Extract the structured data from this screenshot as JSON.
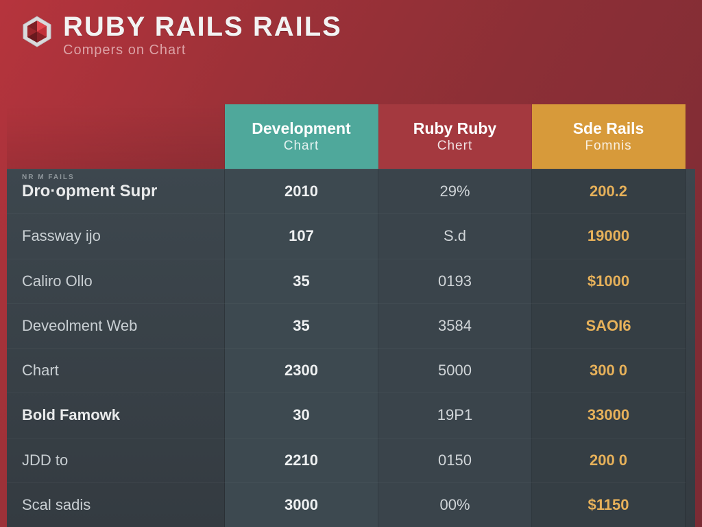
{
  "header": {
    "title": "RUBY RAILS RAILS",
    "subtitle": "Compers on Chart"
  },
  "chart_data": {
    "type": "table",
    "title": "RUBY RAILS RAILS — Compers on Chart",
    "columns": [
      {
        "label": "Development",
        "sub": "Chart"
      },
      {
        "label": "Ruby Ruby",
        "sub": "Chert"
      },
      {
        "label": "Sde Rails",
        "sub": "Fomnis"
      }
    ],
    "rows": [
      {
        "mini": "NR M FAILS",
        "label": "Dro·opment Supr",
        "values": [
          "2010",
          "29%",
          "200.2"
        ],
        "emphasis": "first"
      },
      {
        "label": "Fassway ijo",
        "values": [
          "107",
          "S.d",
          "19000"
        ]
      },
      {
        "label": "Caliro Ollo",
        "values": [
          "35",
          "0193",
          "$1000"
        ],
        "highlight": true
      },
      {
        "label": "Deveolment Web",
        "values": [
          "35",
          "3584",
          "SAOI6"
        ]
      },
      {
        "label": "Chart",
        "values": [
          "2300",
          "5000",
          "300 0"
        ]
      },
      {
        "label": "Bold Famowk",
        "values": [
          "30",
          "19P1",
          "33000"
        ],
        "emphasis": "bold"
      },
      {
        "label": "JDD to",
        "values": [
          "2210",
          "0150",
          "200 0"
        ]
      },
      {
        "label": "Scal sadis",
        "values": [
          "3000",
          "00%",
          "$1150"
        ]
      }
    ]
  }
}
